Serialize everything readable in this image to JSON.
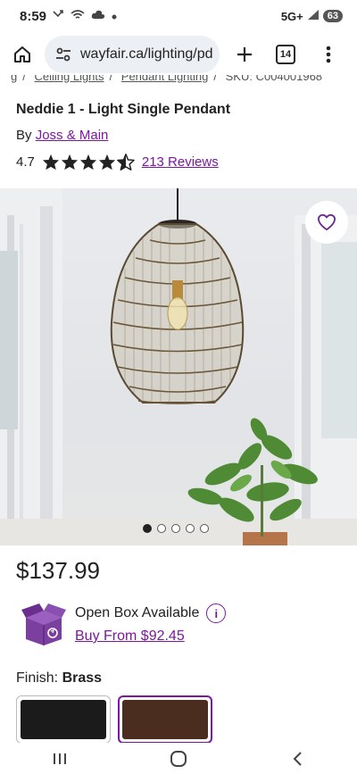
{
  "status_bar": {
    "time": "8:59",
    "network": "5G+",
    "battery": "63"
  },
  "browser": {
    "url": "wayfair.ca/lighting/pd",
    "tab_count": "14"
  },
  "breadcrumb": {
    "items": [
      "g",
      "Ceiling Lights",
      "Pendant Lighting"
    ],
    "sku": "SKU: C004001968"
  },
  "product": {
    "title": "Neddie 1 - Light Single Pendant",
    "by_prefix": "By",
    "brand": "Joss & Main",
    "rating": "4.7",
    "rating_value": 4.7,
    "reviews": "213 Reviews",
    "price": "$137.99"
  },
  "open_box": {
    "label": "Open Box Available",
    "info_glyph": "i",
    "buy_link": "Buy From $92.45"
  },
  "finish": {
    "label": "Finish:",
    "value": "Brass"
  },
  "carousel": {
    "count": 5,
    "active_index": 0
  },
  "colors": {
    "accent_purple": "#7b189f",
    "swatch_black": "#1b1b1b",
    "swatch_bronze": "#4a2d1f"
  }
}
